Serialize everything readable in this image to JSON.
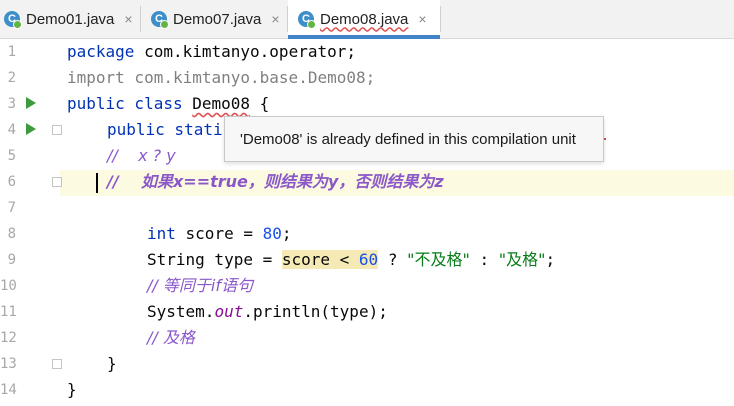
{
  "tabs": [
    {
      "icon_letter": "C",
      "label": "Demo01.java",
      "close": "×",
      "active": false
    },
    {
      "icon_letter": "C",
      "label": "Demo07.java",
      "close": "×",
      "active": false
    },
    {
      "icon_letter": "C",
      "label": "Demo08.java",
      "close": "×",
      "active": true
    }
  ],
  "line_numbers": [
    "1",
    "2",
    "3",
    "4",
    "5",
    "6",
    "7",
    "8",
    "9",
    "10",
    "11",
    "12",
    "13",
    "14"
  ],
  "code": {
    "l1_kw": "package",
    "l1_rest": " com.kimtanyo.operator;",
    "l2": "import com.kimtanyo.base.Demo08;",
    "l3_kw": "public class",
    "l3_name": "Demo08",
    "l3_rest": " {",
    "l4_kw": "public stati",
    "l5_cmt": "//    x ? y",
    "l6_prefix": "//    ",
    "l6_zh": "如果x==true，则结果为y，否则结果为z",
    "l8_kw": "int",
    "l8_mid": " score = ",
    "l8_num": "80",
    "l8_end": ";",
    "l9_a": "String type = ",
    "l9_hl_a": "score < ",
    "l9_hl_num": "60",
    "l9_b": " ? ",
    "l9_s1": "\"不及格\"",
    "l9_c": " : ",
    "l9_s2": "\"及格\"",
    "l9_end": ";",
    "l10_prefix": "// ",
    "l10_zh": "等同于if语句",
    "l11_a": "System.",
    "l11_field": "out",
    "l11_b": ".println(type);",
    "l12_prefix": "// ",
    "l12_zh": "及格",
    "l13": "}",
    "l14": "}"
  },
  "tooltip": {
    "text": "'Demo08' is already defined in this compilation unit"
  },
  "colors": {
    "keyword": "#0033b3",
    "number": "#1750eb",
    "string": "#067d17",
    "comment": "#8a58c9",
    "accent": "#4083c9"
  }
}
